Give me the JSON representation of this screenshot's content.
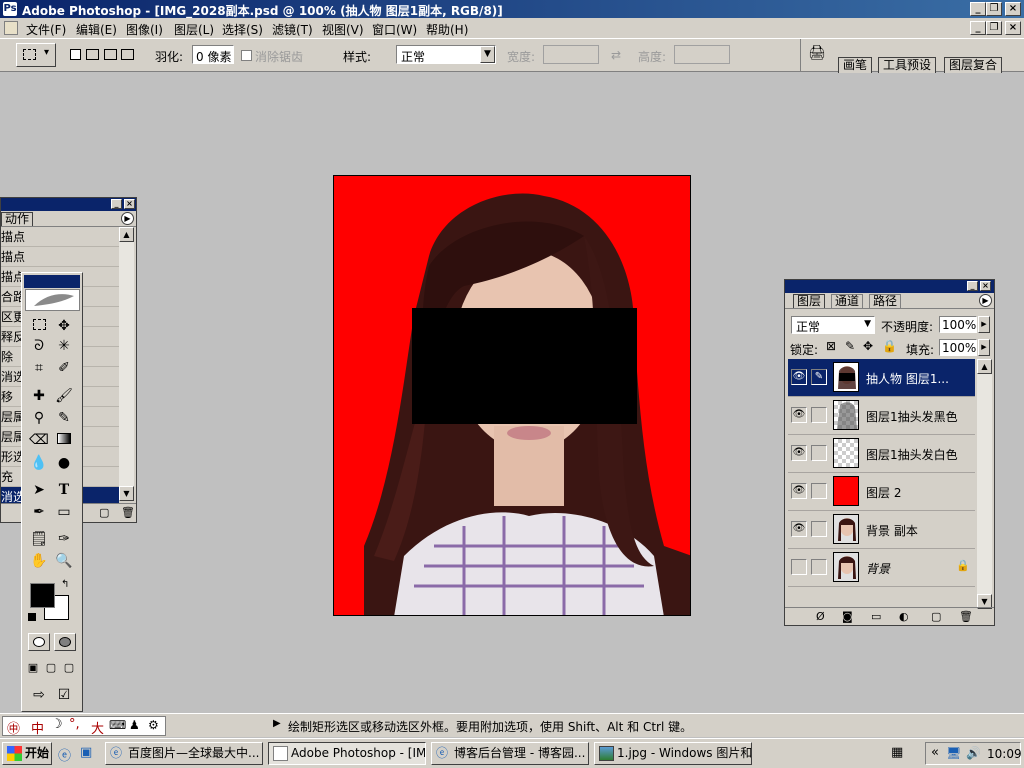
{
  "app": {
    "title": "Adobe Photoshop - [IMG_2028副本.psd @ 100% (抽人物 图层1副本, RGB/8)]"
  },
  "menu": [
    "文件(F)",
    "编辑(E)",
    "图像(I)",
    "图层(L)",
    "选择(S)",
    "滤镜(T)",
    "视图(V)",
    "窗口(W)",
    "帮助(H)"
  ],
  "options": {
    "feather_label": "羽化:",
    "feather_value": "0 像素",
    "antialias_label": "消除锯齿",
    "style_label": "样式:",
    "style_value": "正常",
    "width_label": "宽度:",
    "height_label": "高度:",
    "palette_tabs": [
      "画笔",
      "工具预设",
      "图层复合"
    ]
  },
  "actions_panel": {
    "tab": "动作",
    "items": [
      "描点",
      "描点",
      "描点",
      "合路",
      "区更",
      "释反",
      "除",
      "消选",
      "移",
      "层属",
      "层属",
      "形选",
      "充",
      "消选"
    ],
    "selected_index": 13
  },
  "layers_panel": {
    "tabs": [
      "图层",
      "通道",
      "路径"
    ],
    "blend_mode": "正常",
    "opacity_label": "不透明度:",
    "opacity_value": "100%",
    "lock_label": "锁定:",
    "fill_label": "填充:",
    "fill_value": "100%",
    "layers": [
      {
        "name": "抽人物 图层1...",
        "visible": true,
        "selected": true
      },
      {
        "name": "图层1抽头发黑色",
        "visible": true,
        "selected": false
      },
      {
        "name": "图层1抽头发白色",
        "visible": true,
        "selected": false
      },
      {
        "name": "图层 2",
        "visible": true,
        "selected": false
      },
      {
        "name": "背景 副本",
        "visible": true,
        "selected": false
      },
      {
        "name": "背景",
        "visible": false,
        "selected": false,
        "locked": true
      }
    ]
  },
  "status": {
    "ime_text": "中",
    "ime_full": "大",
    "message": "绘制矩形选区或移动选区外框。要用附加选项，使用 Shift、Alt 和 Ctrl 键。"
  },
  "taskbar": {
    "start_label": "开始",
    "buttons": [
      {
        "label": "百度图片—全球最大中...",
        "active": false
      },
      {
        "label": "Adobe Photoshop - [IMG...",
        "active": true
      },
      {
        "label": "博客后台管理 - 博客园...",
        "active": false
      },
      {
        "label": "1.jpg - Windows 图片和...",
        "active": false
      }
    ],
    "tray_chevron": "«",
    "clock": "10:09"
  },
  "colors": {
    "canvas_background": "#ff0000",
    "titlebar": "#0a246a",
    "selection": "#0a246a",
    "face_block": "#000000"
  }
}
